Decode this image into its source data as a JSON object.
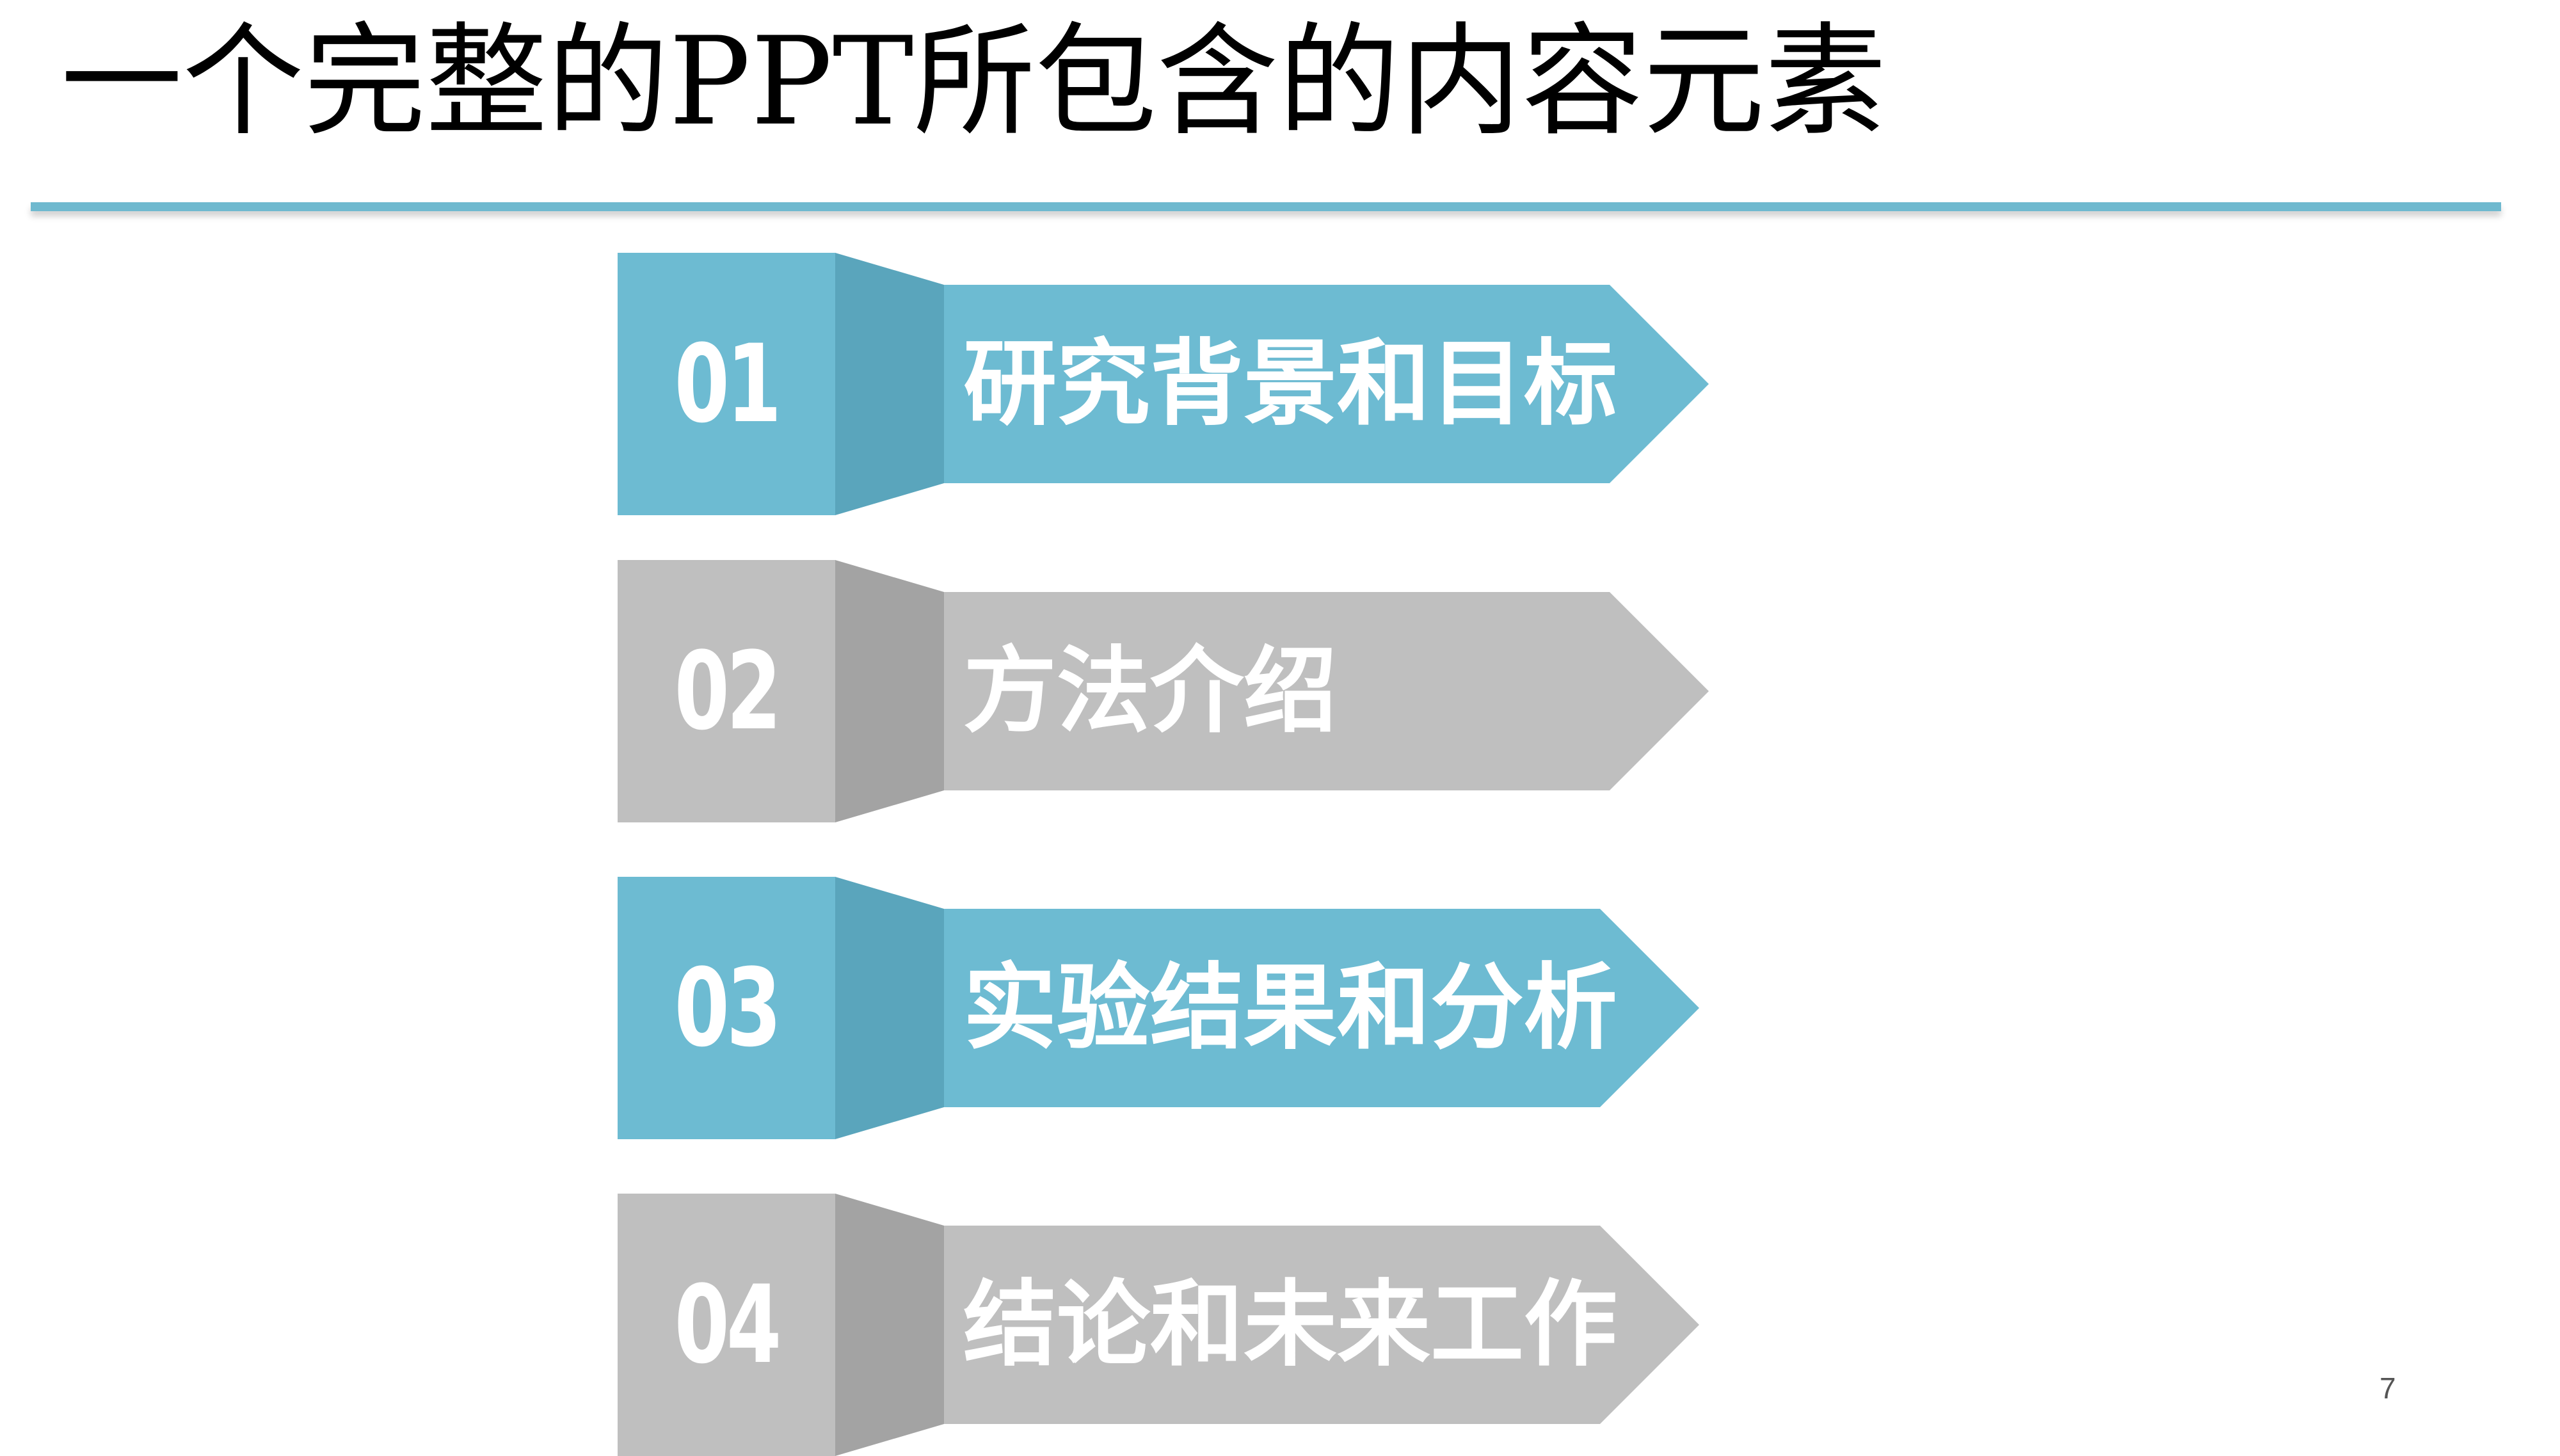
{
  "slide": {
    "title": "一个完整的PPT所包含的内容元素",
    "page_number": "7"
  },
  "items": [
    {
      "number": "01",
      "label": "研究背景和目标",
      "color": "#6dbbd2",
      "dark_color": "#5aa5bc"
    },
    {
      "number": "02",
      "label": "方法介绍",
      "color": "#bfbfbf",
      "dark_color": "#a3a3a3"
    },
    {
      "number": "03",
      "label": "实验结果和分析",
      "color": "#6dbbd2",
      "dark_color": "#5aa5bc"
    },
    {
      "number": "04",
      "label": "结论和未来工作",
      "color": "#bfbfbf",
      "dark_color": "#a3a3a3"
    }
  ]
}
